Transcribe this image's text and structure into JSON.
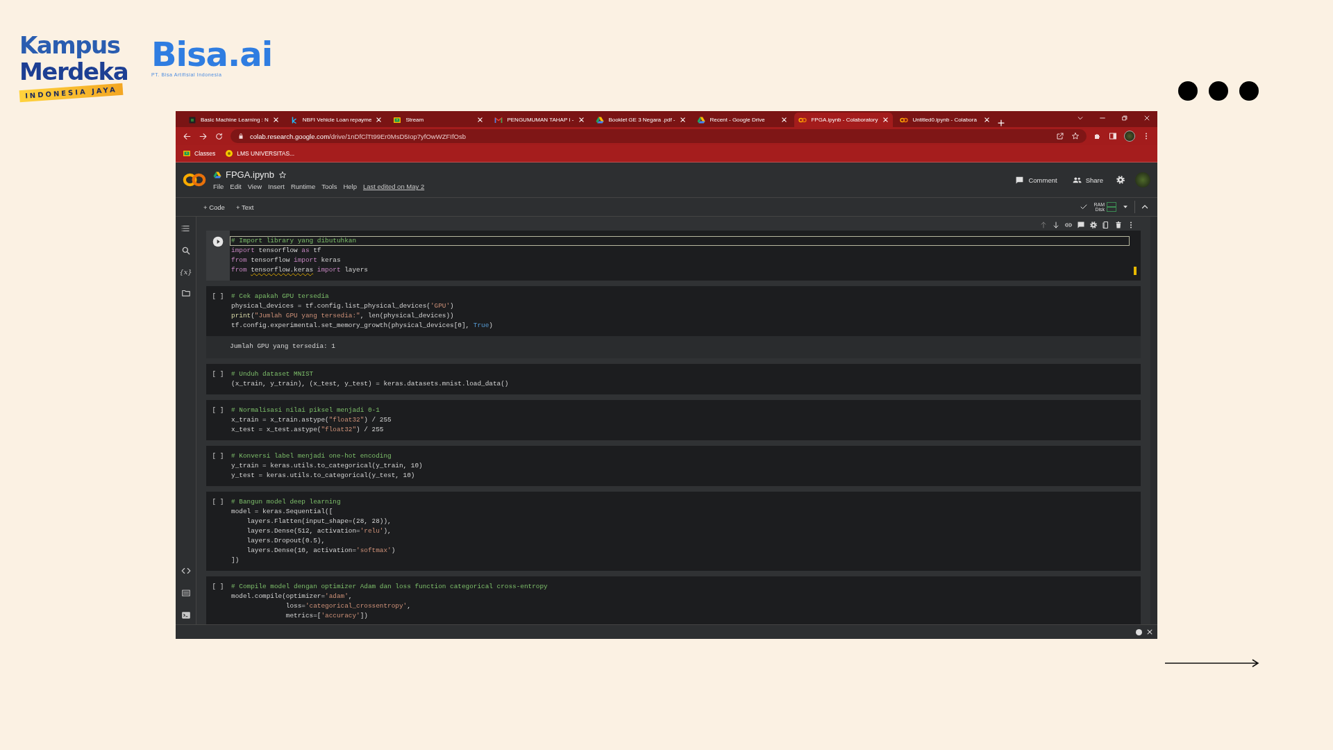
{
  "logos": {
    "kampus_merdeka": {
      "lines": [
        "Kampus",
        "Merdeka"
      ],
      "ribbon": "INDONESIA JAYA"
    },
    "bisa_ai": {
      "name": "Bisa.ai",
      "tagline": "PT. Bisa Artifisial Indonesia"
    }
  },
  "browser": {
    "tabs": [
      {
        "title": "Basic Machine Learning : N",
        "kind": "page",
        "selected": false
      },
      {
        "title": "NBFI Vehicle Loan repayme",
        "kind": "k-mark",
        "selected": false
      },
      {
        "title": "Stream",
        "kind": "board",
        "selected": false
      },
      {
        "title": "PENGUMUMAN TAHAP I -",
        "kind": "envelope",
        "selected": false
      },
      {
        "title": "Booklet GE 3 Negara .pdf -",
        "kind": "triangle",
        "selected": false
      },
      {
        "title": "Recent - Google Drive",
        "kind": "triangle",
        "selected": false
      },
      {
        "title": "FPGA.ipynb - Colaboratory",
        "kind": "rings",
        "selected": true
      },
      {
        "title": "Untitled0.ipynb - Colabora",
        "kind": "rings",
        "selected": false
      }
    ],
    "address": {
      "host": "colab.research.google.com",
      "path": "/drive/1nDfClTt99Er0MsD5Iop7yfOwWZFIfOsb"
    },
    "bookmarks": [
      {
        "label": "Classes",
        "kind": "board"
      },
      {
        "label": "LMS UNIVERSITAS...",
        "kind": "badge"
      }
    ]
  },
  "notebook": {
    "title": "FPGA.ipynb",
    "menu": [
      "File",
      "Edit",
      "View",
      "Insert",
      "Runtime",
      "Tools",
      "Help"
    ],
    "last_edited": "Last edited on May 2",
    "actions": [
      {
        "label": "Comment",
        "kind": "comment"
      },
      {
        "label": "Share",
        "kind": "share"
      }
    ],
    "toolbar": [
      "+ Code",
      "+ Text"
    ],
    "resources": {
      "ram": "RAM",
      "disk": "Disk"
    },
    "sidebar": {
      "top": [
        {
          "kind": "menu"
        },
        {
          "kind": "search"
        },
        {
          "kind": "text",
          "text": "{x}"
        },
        {
          "kind": "folder"
        }
      ],
      "bottom": [
        {
          "kind": "code"
        },
        {
          "kind": "list"
        },
        {
          "kind": "terminal"
        }
      ]
    },
    "cells": [
      {
        "focused": true,
        "lines": [
          [
            {
              "text": "# Import library yang dibutuhkan",
              "kind": "comment"
            }
          ],
          [
            {
              "text": "import",
              "kind": "kw"
            },
            {
              "text": " tensorflow ",
              "kind": "plain"
            },
            {
              "text": "as",
              "kind": "kw"
            },
            {
              "text": " tf",
              "kind": "plain"
            }
          ],
          [
            {
              "text": "from",
              "kind": "kw"
            },
            {
              "text": " tensorflow ",
              "kind": "plain"
            },
            {
              "text": "import",
              "kind": "kw"
            },
            {
              "text": " keras",
              "kind": "plain"
            }
          ],
          [
            {
              "text": "from ",
              "kind": "kw"
            },
            {
              "text": "tensorflow.keras",
              "kind": "warn"
            },
            {
              "text": " import",
              "kind": "kw"
            },
            {
              "text": " layers",
              "kind": "plain"
            }
          ]
        ]
      },
      {
        "focused": false,
        "prompt": "[ ]",
        "lines": [
          [
            {
              "text": "# Cek apakah GPU tersedia",
              "kind": "comment"
            }
          ],
          [
            {
              "text": "physical_devices = tf.config.list_physical_devices(",
              "kind": "plain"
            },
            {
              "text": "'GPU'",
              "kind": "str"
            },
            {
              "text": ")",
              "kind": "plain"
            }
          ],
          [
            {
              "text": "print",
              "kind": "fn"
            },
            {
              "text": "(",
              "kind": "plain"
            },
            {
              "text": "\"Jumlah GPU yang tersedia:\"",
              "kind": "str"
            },
            {
              "text": ", len(physical_devices))",
              "kind": "plain"
            }
          ],
          [
            {
              "text": "tf.config.experimental.set_memory_growth(physical_devices[0], ",
              "kind": "plain"
            },
            {
              "text": "True",
              "kind": "const"
            },
            {
              "text": ")",
              "kind": "plain"
            }
          ]
        ],
        "output": "Jumlah GPU yang tersedia: 1"
      },
      {
        "focused": false,
        "prompt": "[ ]",
        "lines": [
          [
            {
              "text": "# Unduh dataset MNIST",
              "kind": "comment"
            }
          ],
          [
            {
              "text": "(x_train, y_train), (x_test, y_test) = keras.datasets.mnist.load_data()",
              "kind": "plain"
            }
          ]
        ]
      },
      {
        "focused": false,
        "prompt": "[ ]",
        "lines": [
          [
            {
              "text": "# Normalisasi nilai piksel menjadi 0-1",
              "kind": "comment"
            }
          ],
          [
            {
              "text": "x_train = x_train.astype(",
              "kind": "plain"
            },
            {
              "text": "\"float32\"",
              "kind": "str"
            },
            {
              "text": ") / 255",
              "kind": "plain"
            }
          ],
          [
            {
              "text": "x_test = x_test.astype(",
              "kind": "plain"
            },
            {
              "text": "\"float32\"",
              "kind": "str"
            },
            {
              "text": ") / 255",
              "kind": "plain"
            }
          ]
        ]
      },
      {
        "focused": false,
        "prompt": "[ ]",
        "lines": [
          [
            {
              "text": "# Konversi label menjadi one-hot encoding",
              "kind": "comment"
            }
          ],
          [
            {
              "text": "y_train = keras.utils.to_categorical(y_train, 10)",
              "kind": "plain"
            }
          ],
          [
            {
              "text": "y_test = keras.utils.to_categorical(y_test, 10)",
              "kind": "plain"
            }
          ]
        ]
      },
      {
        "focused": false,
        "prompt": "[ ]",
        "lines": [
          [
            {
              "text": "# Bangun model deep learning",
              "kind": "comment"
            }
          ],
          [
            {
              "text": "model = keras.Sequential([",
              "kind": "plain"
            }
          ],
          [
            {
              "text": "    layers.Flatten(input_shape=(28, 28)),",
              "kind": "plain"
            }
          ],
          [
            {
              "text": "    layers.Dense(512, activation=",
              "kind": "plain"
            },
            {
              "text": "'relu'",
              "kind": "str"
            },
            {
              "text": "),",
              "kind": "plain"
            }
          ],
          [
            {
              "text": "    layers.Dropout(0.5),",
              "kind": "plain"
            }
          ],
          [
            {
              "text": "    layers.Dense(10, activation=",
              "kind": "plain"
            },
            {
              "text": "'softmax'",
              "kind": "str"
            },
            {
              "text": ")",
              "kind": "plain"
            }
          ],
          [
            {
              "text": "])",
              "kind": "plain"
            }
          ]
        ]
      },
      {
        "focused": false,
        "prompt": "[ ]",
        "lines": [
          [
            {
              "text": "# Compile model dengan optimizer Adam dan loss function categorical cross-entropy",
              "kind": "comment"
            }
          ],
          [
            {
              "text": "model.compile(optimizer=",
              "kind": "plain"
            },
            {
              "text": "'adam'",
              "kind": "str"
            },
            {
              "text": ",",
              "kind": "plain"
            }
          ],
          [
            {
              "text": "              loss=",
              "kind": "plain"
            },
            {
              "text": "'categorical_crossentropy'",
              "kind": "str"
            },
            {
              "text": ",",
              "kind": "plain"
            }
          ],
          [
            {
              "text": "              metrics=[",
              "kind": "plain"
            },
            {
              "text": "'accuracy'",
              "kind": "str"
            },
            {
              "text": "])",
              "kind": "plain"
            }
          ]
        ]
      }
    ]
  }
}
